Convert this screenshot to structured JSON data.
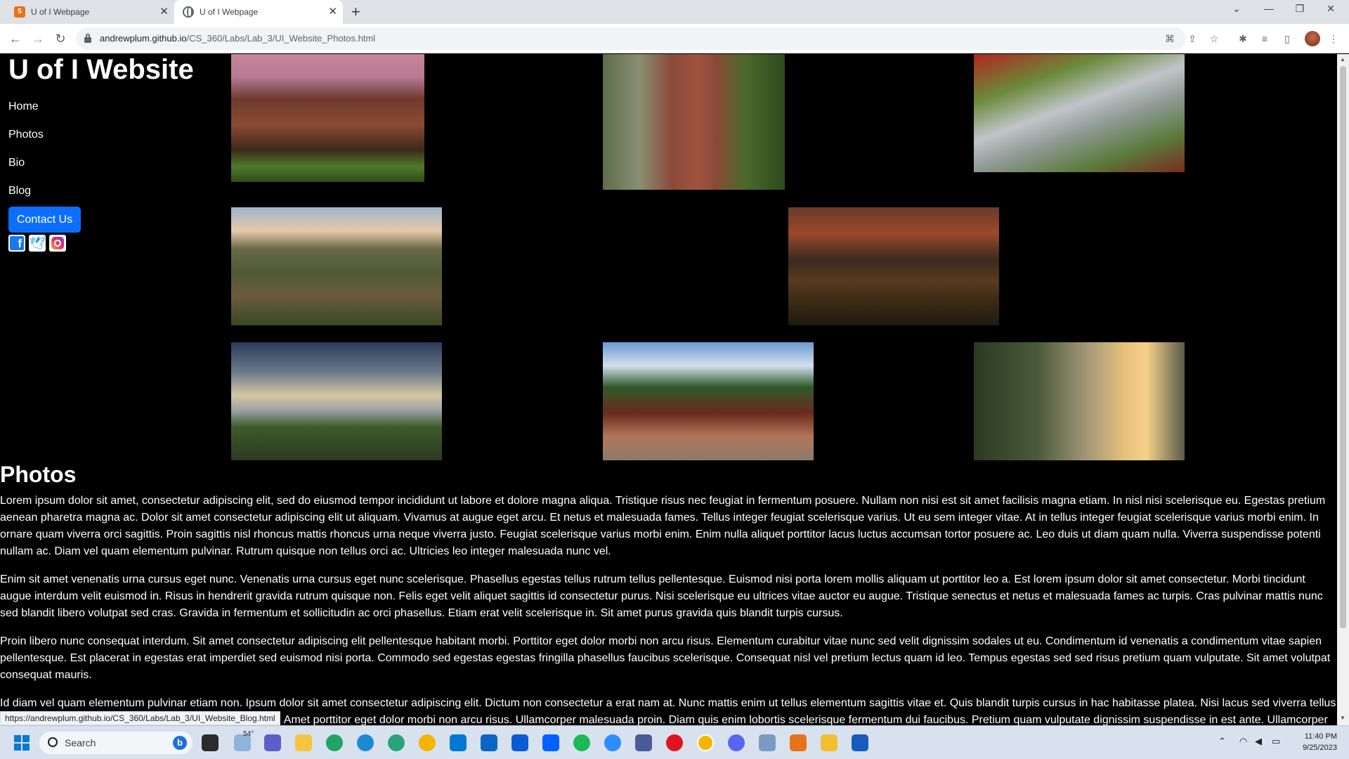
{
  "browser": {
    "tabs": [
      {
        "title": "U of I Webpage",
        "favicon": "orange-html-icon"
      },
      {
        "title": "U of I Webpage",
        "favicon": "globe-icon",
        "active": true
      }
    ],
    "new_tab": "+",
    "url_host": "andrewplum.github.io",
    "url_path": "/CS_360/Labs/Lab_3/UI_Website_Photos.html",
    "hover_status_url": "https://andrewplum.github.io/CS_360/Labs/Lab_3/UI_Website_Blog.html"
  },
  "page": {
    "site_title": "U of I Website",
    "nav": [
      "Home",
      "Photos",
      "Bio",
      "Blog"
    ],
    "contact_label": "Contact Us",
    "social": [
      "facebook-icon",
      "twitter-icon",
      "instagram-icon"
    ],
    "section_title": "Photos",
    "paragraphs": [
      "Lorem ipsum dolor sit amet, consectetur adipiscing elit, sed do eiusmod tempor incididunt ut labore et dolore magna aliqua. Tristique risus nec feugiat in fermentum posuere. Nullam non nisi est sit amet facilisis magna etiam. In nisl nisi scelerisque eu. Egestas pretium aenean pharetra magna ac. Dolor sit amet consectetur adipiscing elit ut aliquam. Vivamus at augue eget arcu. Et netus et malesuada fames. Tellus integer feugiat scelerisque varius. Ut eu sem integer vitae. At in tellus integer feugiat scelerisque varius morbi enim. In ornare quam viverra orci sagittis. Proin sagittis nisl rhoncus mattis rhoncus urna neque viverra justo. Feugiat scelerisque varius morbi enim. Enim nulla aliquet porttitor lacus luctus accumsan tortor posuere ac. Leo duis ut diam quam nulla. Viverra suspendisse potenti nullam ac. Diam vel quam elementum pulvinar. Rutrum quisque non tellus orci ac. Ultricies leo integer malesuada nunc vel.",
      "Enim sit amet venenatis urna cursus eget nunc. Venenatis urna cursus eget nunc scelerisque. Phasellus egestas tellus rutrum tellus pellentesque. Euismod nisi porta lorem mollis aliquam ut porttitor leo a. Est lorem ipsum dolor sit amet consectetur. Morbi tincidunt augue interdum velit euismod in. Risus in hendrerit gravida rutrum quisque non. Felis eget velit aliquet sagittis id consectetur purus. Nisi scelerisque eu ultrices vitae auctor eu augue. Tristique senectus et netus et malesuada fames ac turpis. Cras pulvinar mattis nunc sed blandit libero volutpat sed cras. Gravida in fermentum et sollicitudin ac orci phasellus. Etiam erat velit scelerisque in. Sit amet purus gravida quis blandit turpis cursus.",
      "Proin libero nunc consequat interdum. Sit amet consectetur adipiscing elit pellentesque habitant morbi. Porttitor eget dolor morbi non arcu risus. Elementum curabitur vitae nunc sed velit dignissim sodales ut eu. Condimentum id venenatis a condimentum vitae sapien pellentesque. Est placerat in egestas erat imperdiet sed euismod nisi porta. Commodo sed egestas egestas fringilla phasellus faucibus scelerisque. Consequat nisl vel pretium lectus quam id leo. Tempus egestas sed sed risus pretium quam vulputate. Sit amet volutpat consequat mauris.",
      "Id diam vel quam elementum pulvinar etiam non. Ipsum dolor sit amet consectetur adipiscing elit. Dictum non consectetur a erat nam at. Nunc mattis enim ut tellus elementum sagittis vitae et. Quis blandit turpis cursus in hac habitasse platea. Nisi lacus sed viverra tellus in hac habitasse platea dictumst vestibulum rhoncus est. Amet porttitor eget dolor morbi non arcu risus. Ullamcorper malesuada proin. Diam quis enim lobortis scelerisque fermentum dui faucibus. Pretium quam vulputate dignissim suspendisse in est ante. Ullamcorper malesuada proin libero nunc consequat interdum. Sem"
    ]
  },
  "taskbar": {
    "search_label": "Search",
    "time": "11:40 PM",
    "date": "9/25/2023",
    "weather": "54°"
  }
}
